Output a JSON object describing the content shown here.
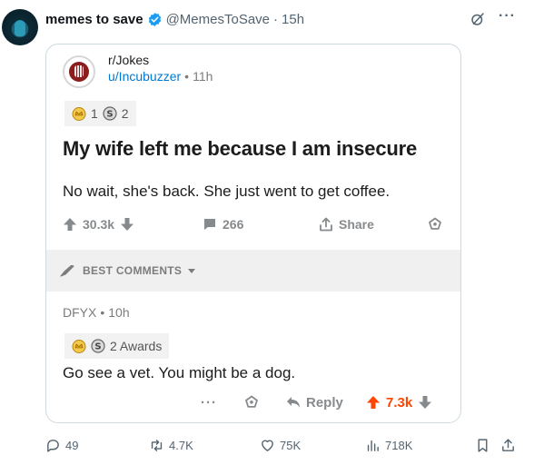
{
  "tweet": {
    "display_name": "memes to save",
    "handle": "@MemesToSave",
    "separator": "·",
    "time": "15h",
    "more_label": "···",
    "stats": {
      "replies": "49",
      "retweets": "4.7K",
      "likes": "75K",
      "views": "718K"
    }
  },
  "reddit_post": {
    "subreddit": "r/Jokes",
    "username": "u/Incubuzzer",
    "separator": "•",
    "time": "11h",
    "award_count_1": "1",
    "award_count_2": "2",
    "title": "My wife left me because I am insecure",
    "body": "No wait, she's back. She just went to get coffee.",
    "upvotes": "30.3k",
    "comments": "266",
    "share_label": "Share"
  },
  "best_comments": {
    "label": "BEST COMMENTS"
  },
  "comment": {
    "author": "DFYX",
    "separator": "•",
    "time": "10h",
    "awards_label": "2 Awards",
    "text": "Go see a vet. You might be a dog.",
    "more_label": "···",
    "reply_label": "Reply",
    "votes": "7.3k"
  },
  "colors": {
    "verified": "#1d9bf0",
    "reddit_link": "#0079d3",
    "upvoted": "#ff4500",
    "muted": "#536471"
  }
}
